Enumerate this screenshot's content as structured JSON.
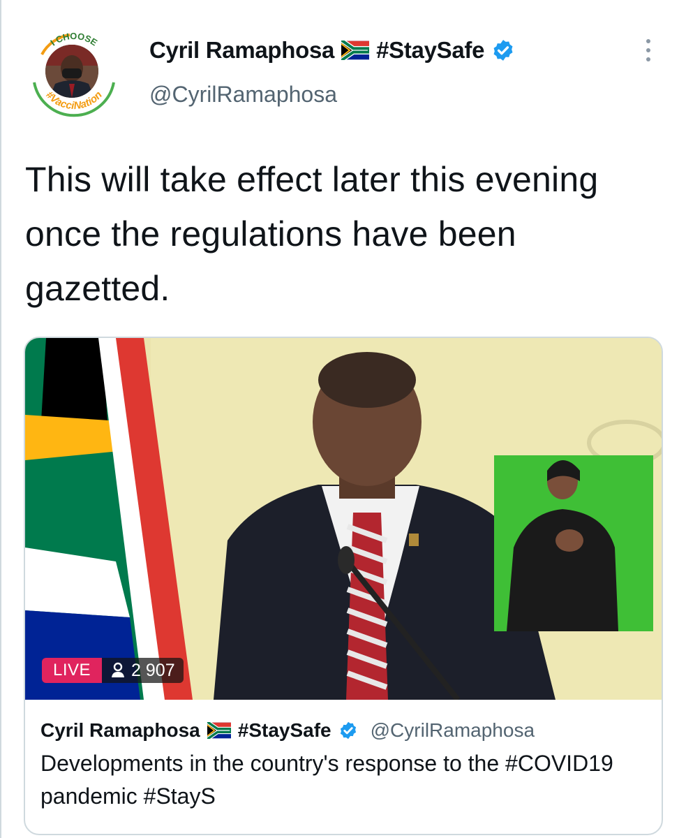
{
  "tweet": {
    "author_name": "Cyril Ramaphosa",
    "author_hashtag": "#StaySafe",
    "author_handle": "@CyrilRamaphosa",
    "avatar_badge_top": "I CHOOSE",
    "avatar_badge_bottom": "#VacciNation",
    "text": "This will take effect later this evening once the regulations have been gazetted."
  },
  "card": {
    "live_label": "LIVE",
    "viewer_count": "2 907",
    "author_name": "Cyril Ramaphosa",
    "author_hashtag": "#StaySafe",
    "author_handle": "@CyrilRamaphosa",
    "description": "Developments in the country's response to the #COVID19 pandemic #StayS"
  },
  "icons": {
    "flag": "south-africa-flag-icon",
    "verified": "verified-badge-icon",
    "more": "more-options-icon",
    "viewer": "person-icon"
  },
  "colors": {
    "verified_blue": "#1d9bf0",
    "live_red": "#e0245e",
    "secondary_text": "#536471",
    "badge_green": "#4caf50",
    "badge_orange": "#f39c12"
  }
}
